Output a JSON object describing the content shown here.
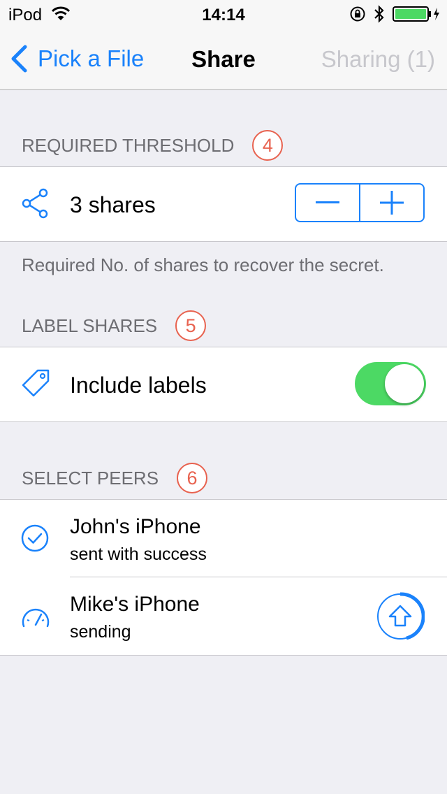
{
  "status_bar": {
    "carrier": "iPod",
    "time": "14:14"
  },
  "nav": {
    "back_label": "Pick a File",
    "title": "Share",
    "right_label": "Sharing (1)"
  },
  "threshold": {
    "header": "REQUIRED THRESHOLD",
    "step": "4",
    "value_label": "3 shares",
    "footer": "Required No. of shares to recover the secret."
  },
  "labels": {
    "header": "LABEL SHARES",
    "step": "5",
    "row_label": "Include labels",
    "toggle_on": true
  },
  "peers": {
    "header": "SELECT PEERS",
    "step": "6",
    "items": [
      {
        "name": "John's iPhone",
        "status": "sent with success"
      },
      {
        "name": "Mike's iPhone",
        "status": "sending"
      }
    ]
  },
  "colors": {
    "accent": "#1a82fb",
    "toggle_on": "#4cd964",
    "badge": "#e8624f"
  }
}
